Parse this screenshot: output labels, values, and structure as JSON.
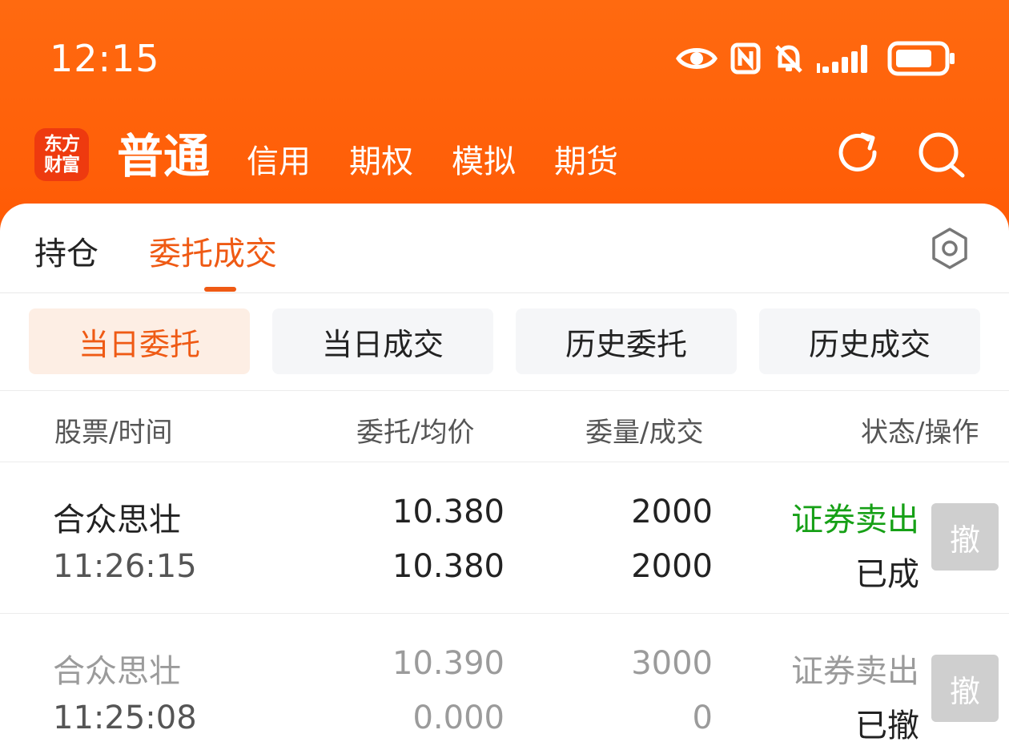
{
  "status_bar": {
    "time": "12:15",
    "icons": [
      "eye-icon",
      "nfc-icon",
      "mute-icon",
      "signal-icon",
      "battery-icon"
    ]
  },
  "app": {
    "logo_line1": "东方",
    "logo_line2": "财富"
  },
  "nav": {
    "tabs": [
      {
        "label": "普通",
        "active": true
      },
      {
        "label": "信用"
      },
      {
        "label": "期权"
      },
      {
        "label": "模拟"
      },
      {
        "label": "期货"
      }
    ]
  },
  "sub_tabs": {
    "holdings": "持仓",
    "orders": "委托成交"
  },
  "filters": [
    "当日委托",
    "当日成交",
    "历史委托",
    "历史成交"
  ],
  "columns": {
    "stock_time": "股票/时间",
    "price": "委托/均价",
    "qty": "委量/成交",
    "status": "状态/操作"
  },
  "orders": [
    {
      "name": "合众思壮",
      "time": "11:26:15",
      "order_price": "10.380",
      "avg_price": "10.380",
      "order_qty": "2000",
      "filled_qty": "2000",
      "side": "证券卖出",
      "status": "已成",
      "action": "撤"
    },
    {
      "name": "合众思壮",
      "time": "11:25:08",
      "order_price": "10.390",
      "avg_price": "0.000",
      "order_qty": "3000",
      "filled_qty": "0",
      "side": "证券卖出",
      "status": "已撤",
      "action": "撤"
    }
  ],
  "colors": {
    "brand": "#ff5a05",
    "accent": "#ef5a14",
    "sell": "#16a016",
    "muted": "#9b9b9b"
  }
}
